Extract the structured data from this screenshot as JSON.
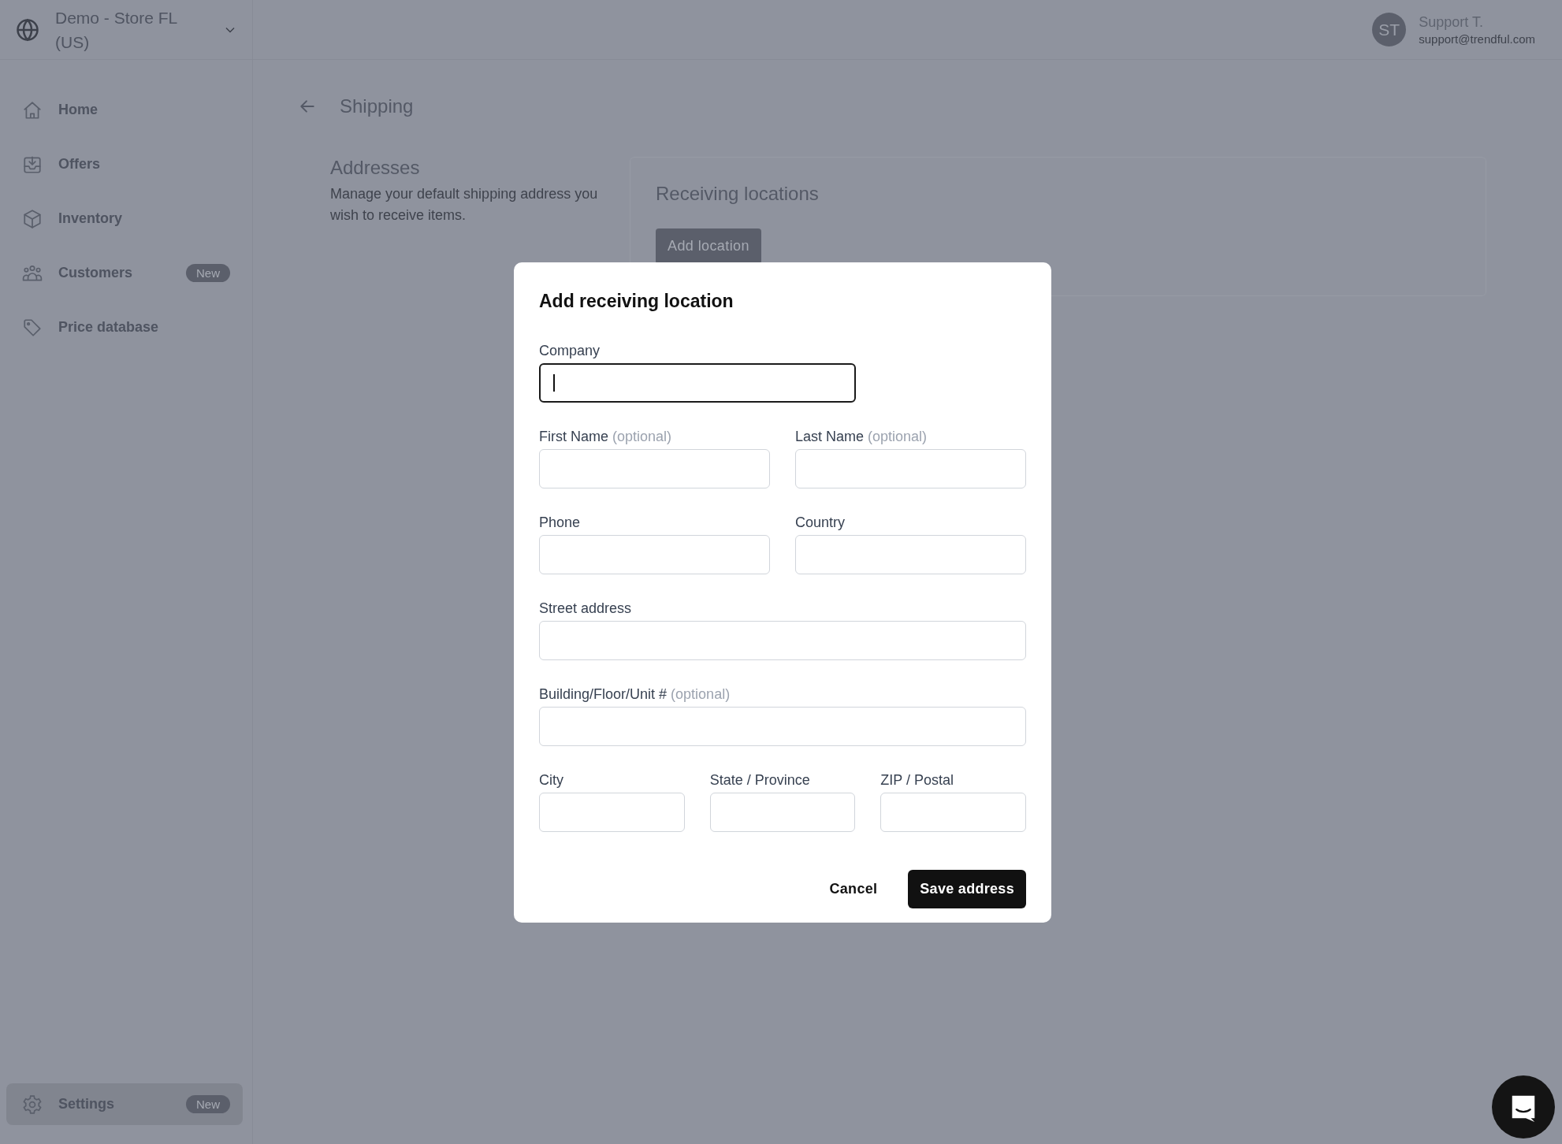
{
  "store_selector": {
    "name": "Demo - Store FL (US)"
  },
  "user": {
    "initials": "ST",
    "name": "Support T.",
    "email": "support@trendful.com"
  },
  "sidebar": {
    "items": [
      {
        "kind": "home",
        "label": "Home",
        "selected": false
      },
      {
        "kind": "offers",
        "label": "Offers",
        "selected": false
      },
      {
        "kind": "inventory",
        "label": "Inventory",
        "selected": false
      },
      {
        "kind": "customers",
        "label": "Customers",
        "badge": "New",
        "selected": false
      },
      {
        "kind": "price",
        "label": "Price database",
        "selected": false
      }
    ],
    "bottom_items": [
      {
        "kind": "settings",
        "label": "Settings",
        "badge": "New",
        "selected": true
      }
    ]
  },
  "page": {
    "title": "Shipping"
  },
  "section": {
    "title": "Addresses",
    "description": "Manage your default shipping address you wish to receive items."
  },
  "card": {
    "title": "Receiving locations",
    "button": "Add location"
  },
  "dialog": {
    "title": "Add receiving location",
    "rows": [
      {
        "kind": "half",
        "fields": [
          {
            "label": "Company",
            "focused": true
          }
        ]
      },
      {
        "kind": "pair",
        "fields": [
          {
            "label": "First Name",
            "hint": "(optional)",
            "focused": false
          },
          {
            "label": "Last Name",
            "hint": "(optional)",
            "focused": false
          }
        ]
      },
      {
        "kind": "pair",
        "fields": [
          {
            "label": "Phone",
            "focused": false
          },
          {
            "label": "Country",
            "focused": false
          }
        ]
      },
      {
        "kind": "wide",
        "fields": [
          {
            "label": "Street address",
            "focused": false
          }
        ]
      },
      {
        "kind": "wide",
        "fields": [
          {
            "label": "Building/Floor/Unit #",
            "hint": "(optional)",
            "focused": false
          }
        ]
      },
      {
        "kind": "triple",
        "fields": [
          {
            "label": "City",
            "focused": false
          },
          {
            "label": "State / Province",
            "focused": false
          },
          {
            "label": "ZIP / Postal",
            "focused": false
          }
        ]
      }
    ],
    "actions": [
      {
        "kind": "secondary",
        "label": "Cancel"
      },
      {
        "kind": "primary",
        "label": "Save address"
      }
    ]
  }
}
